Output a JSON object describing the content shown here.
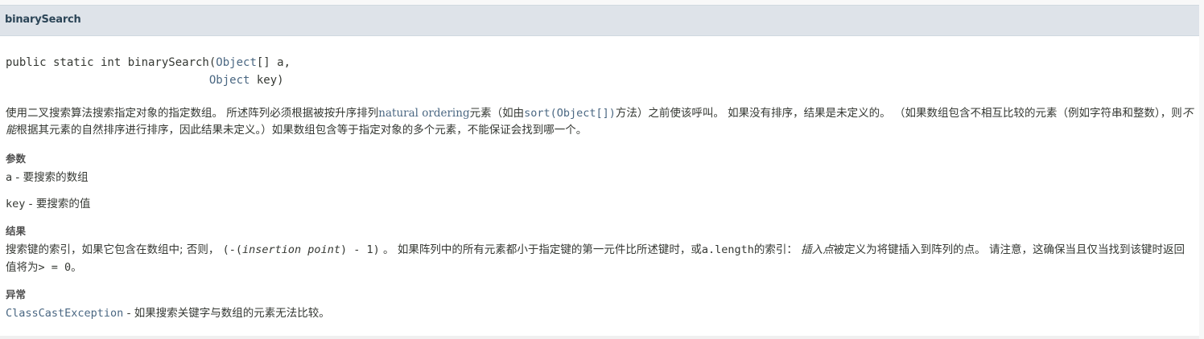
{
  "header": {
    "title": "binarySearch"
  },
  "signature": {
    "prefix": "public static int binarySearch(",
    "type1": "Object",
    "param1": "[] a,",
    "indent": "                              ",
    "type2": "Object",
    "param2": " key)"
  },
  "description": {
    "p1": "使用二叉搜索算法搜索指定对象的指定数组。 所述阵列必须根据被按升序排列",
    "link_natural": "natural ordering",
    "p2": "元素（如由",
    "link_sort": "sort(Object[])",
    "p3": "方法）之前使该呼叫。 如果没有排序，结果是未定义的。 （如果数组包含不相互比较的元素（例如字符串和整数），则",
    "em_cannot": "不能",
    "p4": "根据其元素的自然排序进行排序，因此结果未定义。）如果数组包含等于指定对象的多个元素，不能保证会找到哪一个。"
  },
  "params": {
    "label": "参数",
    "a": {
      "name": "a",
      "desc": " - 要搜索的数组"
    },
    "key": {
      "name": "key",
      "desc": " - 要搜索的值"
    }
  },
  "returns": {
    "label": "结果",
    "r1": "搜索键的索引，如果它包含在数组中; 否则， ",
    "code1": "(-(",
    "code_em": "insertion point",
    "code2": ") - 1)",
    "r2": " 。 如果阵列中的所有元素都小于指定键的第一元件比所述键时，或",
    "code3": "a.length",
    "r3": "的索引： ",
    "em_insert": "插入点",
    "r4": "被定义为将键插入到阵列的点。 请注意，这确保当且仅当找到该键时返回值将为",
    "code4": ">",
    "r5": " = 0。"
  },
  "throws": {
    "label": "异常",
    "exception": "ClassCastException",
    "desc": " - 如果搜索关键字与数组的元素无法比较。"
  }
}
